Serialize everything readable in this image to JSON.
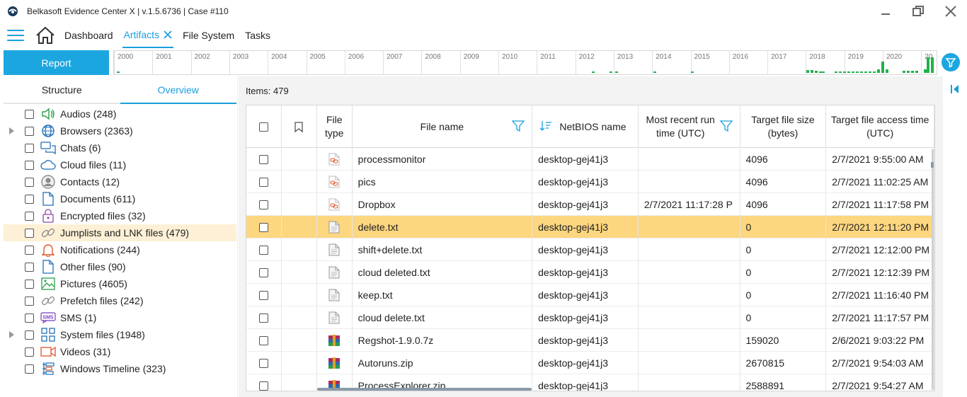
{
  "window": {
    "title": "Belkasoft Evidence Center X | v.1.5.6736 | Case #110"
  },
  "nav": {
    "tabs": [
      {
        "label": "Dashboard"
      },
      {
        "label": "Artifacts"
      },
      {
        "label": "File System"
      },
      {
        "label": "Tasks"
      }
    ]
  },
  "toolbar": {
    "report_label": "Report"
  },
  "timeline": {
    "years": [
      "2000",
      "2001",
      "2002",
      "2003",
      "2004",
      "2005",
      "2006",
      "2007",
      "2008",
      "2009",
      "2010",
      "2011",
      "2012",
      "2013",
      "2014",
      "2015",
      "2016",
      "2017",
      "2018",
      "2019",
      "2020",
      "20"
    ],
    "bar_color": "#22b14c"
  },
  "sidebar": {
    "tabs": [
      {
        "label": "Structure"
      },
      {
        "label": "Overview"
      }
    ],
    "items": [
      {
        "label": "Audios (248)",
        "icon": "speaker-icon"
      },
      {
        "label": "Browsers (2363)",
        "icon": "globe-icon"
      },
      {
        "label": "Chats (6)",
        "icon": "chat-icon"
      },
      {
        "label": "Cloud files (11)",
        "icon": "cloud-icon"
      },
      {
        "label": "Contacts (12)",
        "icon": "contact-icon"
      },
      {
        "label": "Documents (611)",
        "icon": "document-icon"
      },
      {
        "label": "Encrypted files (32)",
        "icon": "lock-icon"
      },
      {
        "label": "Jumplists and LNK files (479)",
        "icon": "link-icon"
      },
      {
        "label": "Notifications (244)",
        "icon": "bell-icon"
      },
      {
        "label": "Other files (90)",
        "icon": "file-icon"
      },
      {
        "label": "Pictures (4605)",
        "icon": "picture-icon"
      },
      {
        "label": "Prefetch files (242)",
        "icon": "link-icon"
      },
      {
        "label": "SMS (1)",
        "icon": "sms-icon"
      },
      {
        "label": "System files (1948)",
        "icon": "system-icon"
      },
      {
        "label": "Videos (31)",
        "icon": "video-icon"
      },
      {
        "label": "Windows Timeline (323)",
        "icon": "timeline-icon"
      }
    ]
  },
  "main": {
    "items_count": "Items: 479",
    "columns": {
      "file_type": "File type",
      "file_name": "File name",
      "netbios": "NetBIOS name",
      "most_recent_run": "Most recent run time (UTC)",
      "target_size": "Target file size (bytes)",
      "target_access": "Target file access time (UTC)"
    },
    "rows": [
      {
        "type": "lnk",
        "name": "processmonitor",
        "netbios": "desktop-gej41j3",
        "run": "",
        "size": "4096",
        "access": "2/7/2021 9:55:00 AM"
      },
      {
        "type": "lnk",
        "name": "pics",
        "netbios": "desktop-gej41j3",
        "run": "",
        "size": "4096",
        "access": "2/7/2021 11:02:25 AM"
      },
      {
        "type": "lnk",
        "name": "Dropbox",
        "netbios": "desktop-gej41j3",
        "run": "2/7/2021 11:17:28 P",
        "size": "4096",
        "access": "2/7/2021 11:17:58 PM"
      },
      {
        "type": "txt",
        "name": "delete.txt",
        "netbios": "desktop-gej41j3",
        "run": "",
        "size": "0",
        "access": "2/7/2021 12:11:20 PM"
      },
      {
        "type": "txt",
        "name": "shift+delete.txt",
        "netbios": "desktop-gej41j3",
        "run": "",
        "size": "0",
        "access": "2/7/2021 12:12:00 PM"
      },
      {
        "type": "txt",
        "name": "cloud deleted.txt",
        "netbios": "desktop-gej41j3",
        "run": "",
        "size": "0",
        "access": "2/7/2021 12:12:39 PM"
      },
      {
        "type": "txt",
        "name": "keep.txt",
        "netbios": "desktop-gej41j3",
        "run": "",
        "size": "0",
        "access": "2/7/2021 11:16:40 PM"
      },
      {
        "type": "txt",
        "name": "cloud delete.txt",
        "netbios": "desktop-gej41j3",
        "run": "",
        "size": "0",
        "access": "2/7/2021 11:17:57 PM"
      },
      {
        "type": "archive",
        "name": "Regshot-1.9.0.7z",
        "netbios": "desktop-gej41j3",
        "run": "",
        "size": "159020",
        "access": "2/6/2021 9:03:22 PM"
      },
      {
        "type": "archive",
        "name": "Autoruns.zip",
        "netbios": "desktop-gej41j3",
        "run": "",
        "size": "2670815",
        "access": "2/7/2021 9:54:03 AM"
      },
      {
        "type": "archive",
        "name": "ProcessExplorer.zip",
        "netbios": "desktop-gej41j3",
        "run": "",
        "size": "2588891",
        "access": "2/7/2021 9:54:27 AM"
      }
    ]
  },
  "colors": {
    "accent": "#1a9fdb",
    "selected_row": "#fdd680",
    "selected_sidebar": "#fdf0d6"
  }
}
